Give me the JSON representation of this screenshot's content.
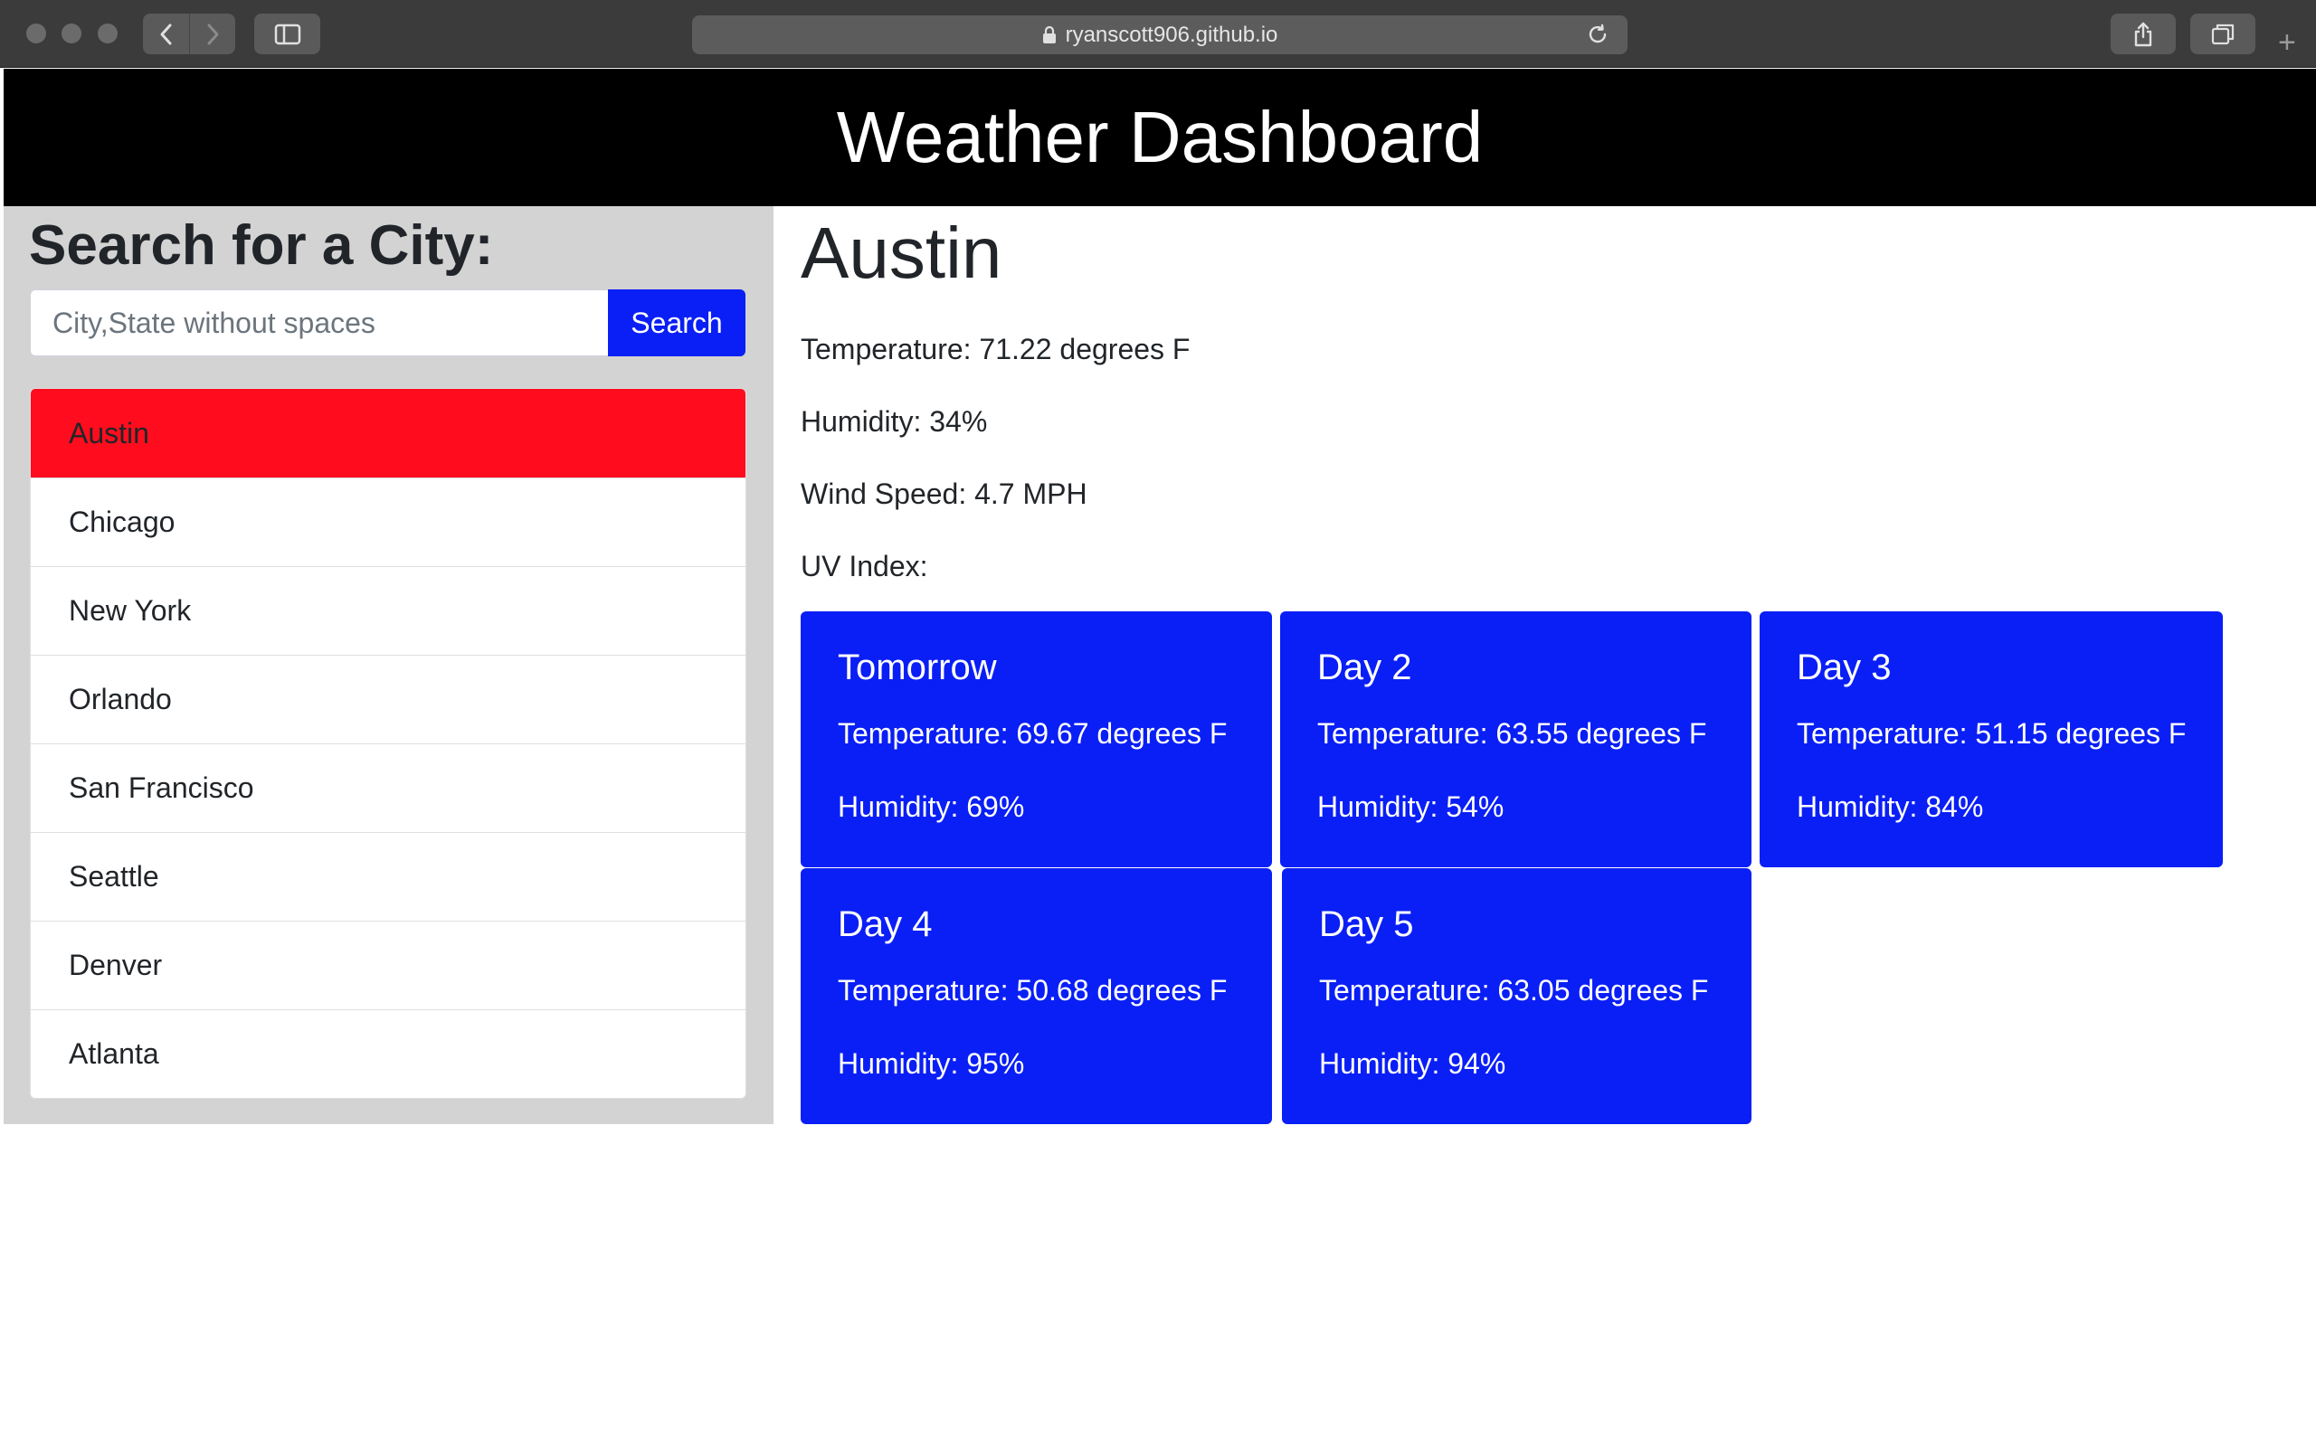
{
  "browser": {
    "url": "ryanscott906.github.io",
    "newtab_label": "+"
  },
  "header": {
    "title": "Weather Dashboard"
  },
  "search": {
    "title": "Search for a City:",
    "placeholder": "City,State without spaces",
    "button_label": "Search"
  },
  "cities": [
    "Austin",
    "Chicago",
    "New York",
    "Orlando",
    "San Francisco",
    "Seattle",
    "Denver",
    "Atlanta"
  ],
  "current": {
    "city": "Austin",
    "temperature": "Temperature: 71.22 degrees F",
    "humidity": "Humidity: 34%",
    "wind": "Wind Speed: 4.7 MPH",
    "uv": "UV Index:"
  },
  "forecast": [
    {
      "day": "Tomorrow",
      "temperature": "Temperature: 69.67 degrees F",
      "humidity": "Humidity: 69%"
    },
    {
      "day": "Day 2",
      "temperature": "Temperature: 63.55 degrees F",
      "humidity": "Humidity: 54%"
    },
    {
      "day": "Day 3",
      "temperature": "Temperature: 51.15 degrees F",
      "humidity": "Humidity: 84%"
    },
    {
      "day": "Day 4",
      "temperature": "Temperature: 50.68 degrees F",
      "humidity": "Humidity: 95%"
    },
    {
      "day": "Day 5",
      "temperature": "Temperature: 63.05 degrees F",
      "humidity": "Humidity: 94%"
    }
  ],
  "colors": {
    "header_bg": "#000000",
    "panel_bg": "#d3d3d3",
    "active_city": "#ff0d1e",
    "accent_blue": "#0a1ff5"
  },
  "icons": {
    "back": "chevron-left-icon",
    "forward": "chevron-right-icon",
    "sidebar": "sidebar-icon",
    "lock": "lock-icon",
    "reload": "reload-icon",
    "share": "share-icon",
    "tabs": "tabs-icon"
  }
}
